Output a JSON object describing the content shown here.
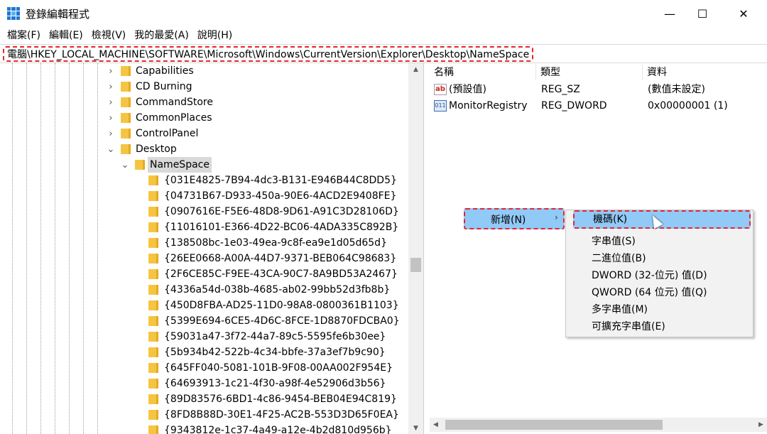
{
  "window": {
    "title": "登錄編輯程式",
    "minimize": "—",
    "maximize": "☐",
    "close": "✕"
  },
  "menu": [
    "檔案(F)",
    "編輯(E)",
    "檢視(V)",
    "我的最愛(A)",
    "說明(H)"
  ],
  "address": "電腦\\HKEY_LOCAL_MACHINE\\SOFTWARE\\Microsoft\\Windows\\CurrentVersion\\Explorer\\Desktop\\NameSpace",
  "tree": {
    "items": [
      {
        "label": "Capabilities",
        "chevron": "›"
      },
      {
        "label": "CD Burning",
        "chevron": "›"
      },
      {
        "label": "CommandStore",
        "chevron": "›"
      },
      {
        "label": "CommonPlaces",
        "chevron": "›"
      },
      {
        "label": "ControlPanel",
        "chevron": "›"
      },
      {
        "label": "Desktop",
        "chevron": "⌄"
      },
      {
        "label": "NameSpace",
        "chevron": "⌄",
        "selected": true
      }
    ],
    "children": [
      "{031E4825-7B94-4dc3-B131-E946B44C8DD5}",
      "{04731B67-D933-450a-90E6-4ACD2E9408FE}",
      "{0907616E-F5E6-48D8-9D61-A91C3D28106D}",
      "{11016101-E366-4D22-BC06-4ADA335C892B}",
      "{138508bc-1e03-49ea-9c8f-ea9e1d05d65d}",
      "{26EE0668-A00A-44D7-9371-BEB064C98683}",
      "{2F6CE85C-F9EE-43CA-90C7-8A9BD53A2467}",
      "{4336a54d-038b-4685-ab02-99bb52d3fb8b}",
      "{450D8FBA-AD25-11D0-98A8-0800361B1103}",
      "{5399E694-6CE5-4D6C-8FCE-1D8870FDCBA0}",
      "{59031a47-3f72-44a7-89c5-5595fe6b30ee}",
      "{5b934b42-522b-4c34-bbfe-37a3ef7b9c90}",
      "{645FF040-5081-101B-9F08-00AA002F954E}",
      "{64693913-1c21-4f30-a98f-4e52906d3b56}",
      "{89D83576-6BD1-4c86-9454-BEB04E94C819}",
      "{8FD8B88D-30E1-4F25-AC2B-553D3D65F0EA}",
      "{9343812e-1c37-4a49-a12e-4b2d810d956b}"
    ]
  },
  "list": {
    "headers": [
      "名稱",
      "類型",
      "資料"
    ],
    "rows": [
      {
        "icon": "string-value-icon",
        "icon_text": "ab",
        "name": "(預設值)",
        "type": "REG_SZ",
        "data": "(數值未設定)"
      },
      {
        "icon": "dword-value-icon",
        "icon_text": "011",
        "name": "MonitorRegistry",
        "type": "REG_DWORD",
        "data": "0x00000001 (1)"
      }
    ]
  },
  "context_menu": {
    "parent_label": "新增(N)",
    "parent_arrow": "›",
    "submenu": [
      "機碼(K)",
      "字串值(S)",
      "二進位值(B)",
      "DWORD (32-位元) 值(D)",
      "QWORD (64 位元) 值(Q)",
      "多字串值(M)",
      "可擴充字串值(E)"
    ]
  },
  "scroll": {
    "up": "▲",
    "down": "▼",
    "left": "◀",
    "right": "▶"
  },
  "colors": {
    "highlight": "#91c9f7",
    "annotation": "#e3262f",
    "folder": "#f5c542"
  }
}
